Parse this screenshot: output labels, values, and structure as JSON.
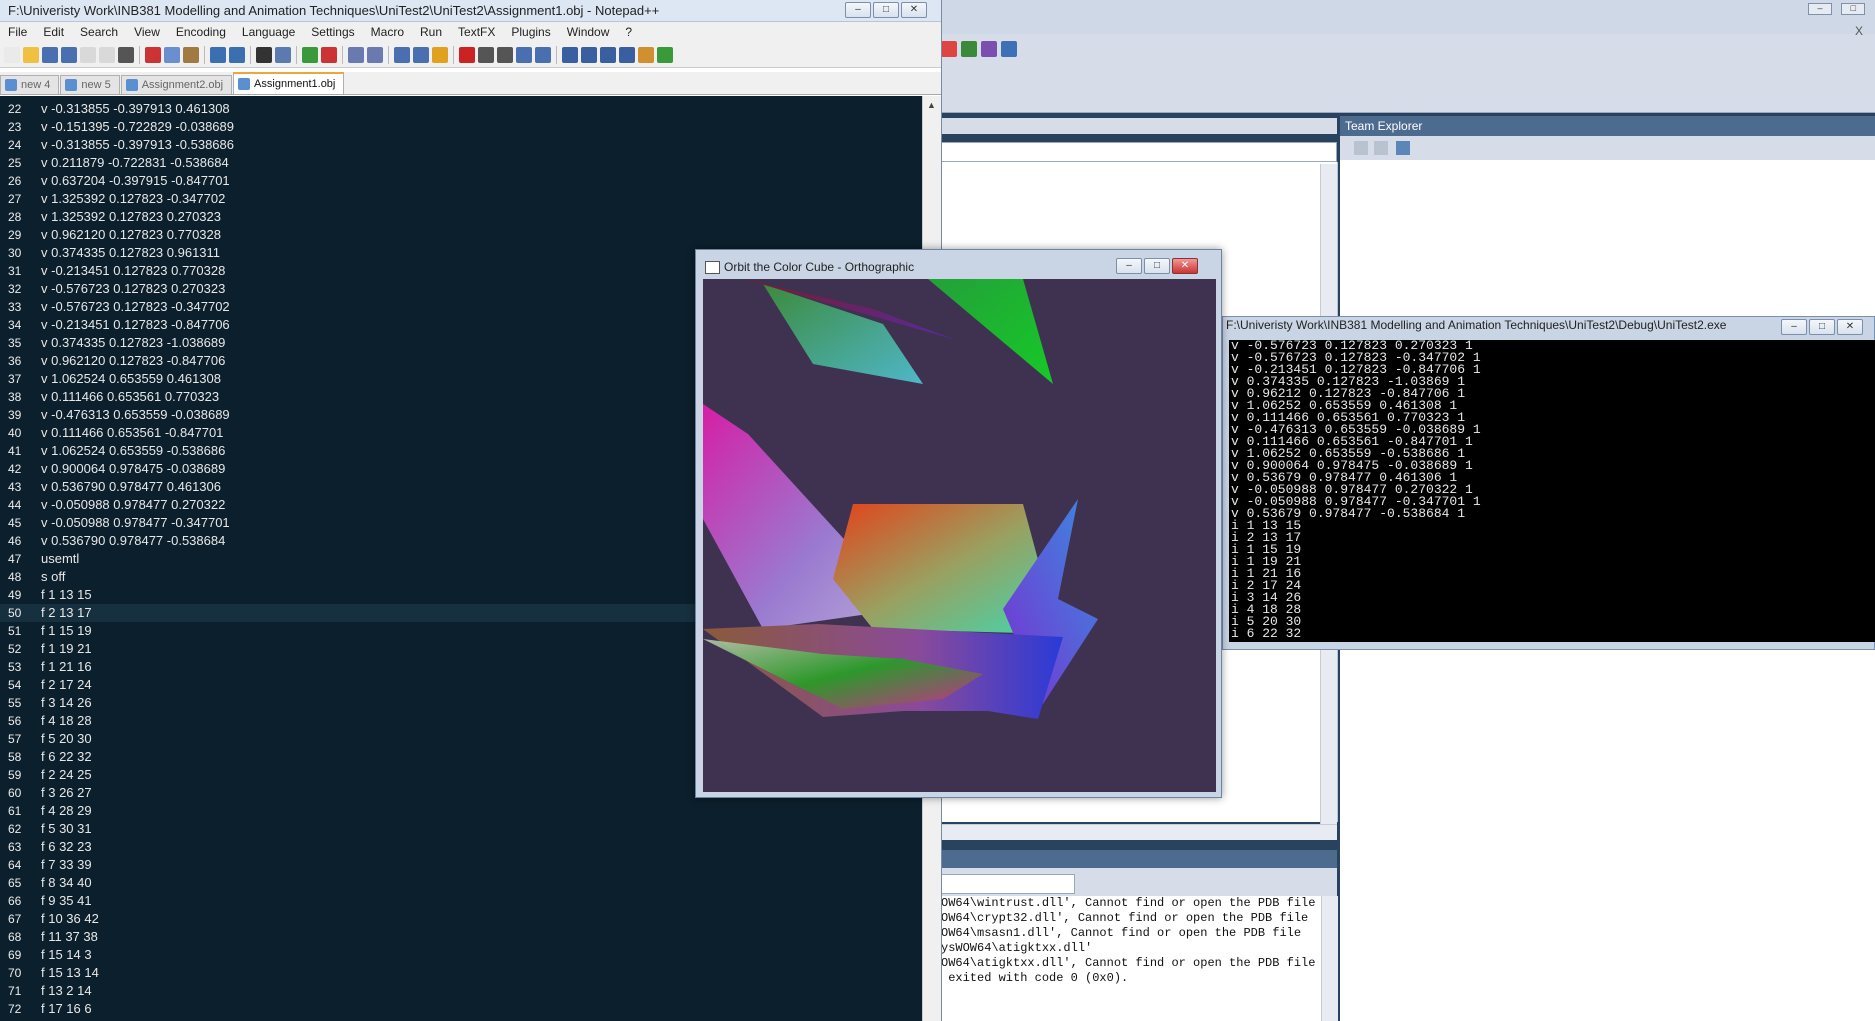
{
  "notepad": {
    "title": "F:\\Univeristy Work\\INB381 Modelling and Animation Techniques\\UniTest2\\UniTest2\\Assignment1.obj - Notepad++",
    "menu": [
      "File",
      "Edit",
      "Search",
      "View",
      "Encoding",
      "Language",
      "Settings",
      "Macro",
      "Run",
      "TextFX",
      "Plugins",
      "Window",
      "?"
    ],
    "menu_close": "X",
    "tabs": [
      {
        "label": "new  4",
        "active": false
      },
      {
        "label": "new  5",
        "active": false
      },
      {
        "label": "Assignment2.obj",
        "active": false
      },
      {
        "label": "Assignment1.obj",
        "active": true
      }
    ],
    "lines": [
      {
        "n": "22",
        "t": "v -0.313855 -0.397913 0.461308"
      },
      {
        "n": "23",
        "t": "v -0.151395 -0.722829 -0.038689"
      },
      {
        "n": "24",
        "t": "v -0.313855 -0.397913 -0.538686"
      },
      {
        "n": "25",
        "t": "v 0.211879 -0.722831 -0.538684"
      },
      {
        "n": "26",
        "t": "v 0.637204 -0.397915 -0.847701"
      },
      {
        "n": "27",
        "t": "v 1.325392 0.127823 -0.347702"
      },
      {
        "n": "28",
        "t": "v 1.325392 0.127823 0.270323"
      },
      {
        "n": "29",
        "t": "v 0.962120 0.127823 0.770328"
      },
      {
        "n": "30",
        "t": "v 0.374335 0.127823 0.961311"
      },
      {
        "n": "31",
        "t": "v -0.213451 0.127823 0.770328"
      },
      {
        "n": "32",
        "t": "v -0.576723 0.127823 0.270323"
      },
      {
        "n": "33",
        "t": "v -0.576723 0.127823 -0.347702"
      },
      {
        "n": "34",
        "t": "v -0.213451 0.127823 -0.847706"
      },
      {
        "n": "35",
        "t": "v 0.374335 0.127823 -1.038689"
      },
      {
        "n": "36",
        "t": "v 0.962120 0.127823 -0.847706"
      },
      {
        "n": "37",
        "t": "v 1.062524 0.653559 0.461308"
      },
      {
        "n": "38",
        "t": "v 0.111466 0.653561 0.770323"
      },
      {
        "n": "39",
        "t": "v -0.476313 0.653559 -0.038689"
      },
      {
        "n": "40",
        "t": "v 0.111466 0.653561 -0.847701"
      },
      {
        "n": "41",
        "t": "v 1.062524 0.653559 -0.538686"
      },
      {
        "n": "42",
        "t": "v 0.900064 0.978475 -0.038689"
      },
      {
        "n": "43",
        "t": "v 0.536790 0.978477 0.461306"
      },
      {
        "n": "44",
        "t": "v -0.050988 0.978477 0.270322"
      },
      {
        "n": "45",
        "t": "v -0.050988 0.978477 -0.347701"
      },
      {
        "n": "46",
        "t": "v 0.536790 0.978477 -0.538684"
      },
      {
        "n": "47",
        "t": "usemtl"
      },
      {
        "n": "48",
        "t": "s off"
      },
      {
        "n": "49",
        "t": "f 1 13 15"
      },
      {
        "n": "50",
        "t": "f 2 13 17"
      },
      {
        "n": "51",
        "t": "f 1 15 19"
      },
      {
        "n": "52",
        "t": "f 1 19 21"
      },
      {
        "n": "53",
        "t": "f 1 21 16"
      },
      {
        "n": "54",
        "t": "f 2 17 24"
      },
      {
        "n": "55",
        "t": "f 3 14 26"
      },
      {
        "n": "56",
        "t": "f 4 18 28"
      },
      {
        "n": "57",
        "t": "f 5 20 30"
      },
      {
        "n": "58",
        "t": "f 6 22 32"
      },
      {
        "n": "59",
        "t": "f 2 24 25"
      },
      {
        "n": "60",
        "t": "f 3 26 27"
      },
      {
        "n": "61",
        "t": "f 4 28 29"
      },
      {
        "n": "62",
        "t": "f 5 30 31"
      },
      {
        "n": "63",
        "t": "f 6 32 23"
      },
      {
        "n": "64",
        "t": "f 7 33 39"
      },
      {
        "n": "65",
        "t": "f 8 34 40"
      },
      {
        "n": "66",
        "t": "f 9 35 41"
      },
      {
        "n": "67",
        "t": "f 10 36 42"
      },
      {
        "n": "68",
        "t": "f 11 37 38"
      },
      {
        "n": "69",
        "t": "f 15 14 3"
      },
      {
        "n": "70",
        "t": "f 15 13 14"
      },
      {
        "n": "71",
        "t": "f 13 2 14"
      },
      {
        "n": "72",
        "t": "f 17 16 6"
      }
    ],
    "current_line": "50"
  },
  "gl_window": {
    "title": "Orbit the Color Cube - Orthographic",
    "background": "#3f3251"
  },
  "console": {
    "title": "F:\\Univeristy Work\\INB381 Modelling and Animation Techniques\\UniTest2\\Debug\\UniTest2.exe",
    "lines": [
      "v -0.576723 0.127823 0.270323 1",
      "v -0.576723 0.127823 -0.347702 1",
      "v -0.213451 0.127823 -0.847706 1",
      "v 0.374335 0.127823 -1.03869 1",
      "v 0.96212 0.127823 -0.847706 1",
      "v 1.06252 0.653559 0.461308 1",
      "v 0.111466 0.653561 0.770323 1",
      "v -0.476313 0.653559 -0.038689 1",
      "v 0.111466 0.653561 -0.847701 1",
      "v 1.06252 0.653559 -0.538686 1",
      "v 0.900064 0.978475 -0.038689 1",
      "v 0.53679 0.978477 0.461306 1",
      "v -0.050988 0.978477 0.270322 1",
      "v -0.050988 0.978477 -0.347701 1",
      "v 0.53679 0.978477 -0.538684 1",
      "i 1 13 15",
      "i 2 13 17",
      "i 1 15 19",
      "i 1 19 21",
      "i 1 21 16",
      "i 2 17 24",
      "i 3 14 26",
      "i 4 18 28",
      "i 5 20 30",
      "i 6 22 32"
    ]
  },
  "visual_studio": {
    "team_explorer_title": "Team Explorer",
    "output_lines": [
      "OW64\\wintrust.dll', Cannot find or open the PDB file",
      "OW64\\crypt32.dll', Cannot find or open the PDB file",
      "OW64\\msasn1.dll', Cannot find or open the PDB file",
      "ysWOW64\\atigktxx.dll'",
      "OW64\\atigktxx.dll', Cannot find or open the PDB file",
      " exited with code 0 (0x0)."
    ]
  },
  "window_buttons": {
    "minimize": "–",
    "maximize": "□",
    "close": "✕"
  }
}
